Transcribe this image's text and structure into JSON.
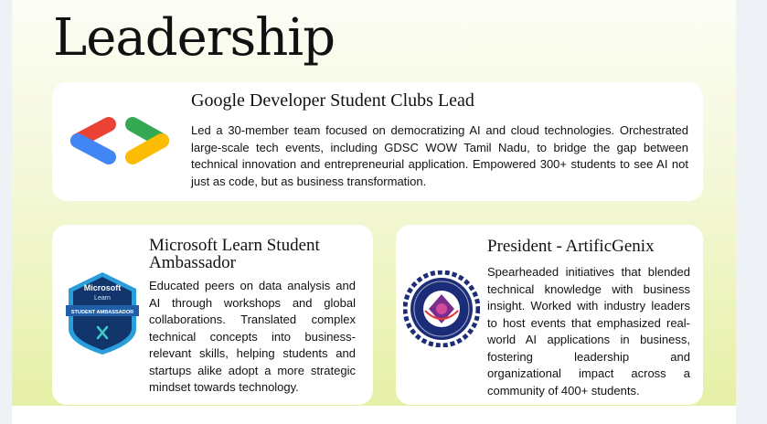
{
  "page": {
    "title": "Leadership"
  },
  "cards": {
    "gdsc": {
      "title": "Google Developer Student Clubs Lead",
      "text": "Led a 30-member team focused on democratizing AI and cloud technologies. Orchestrated large-scale tech events, including GDSC WOW Tamil Nadu, to bridge the gap between technical innovation and entrepreneurial application. Empowered 300+ students to see AI not just as code, but as business transformation.",
      "icon": "google-developers-logo"
    },
    "microsoft": {
      "title": "Microsoft Learn Student Ambassador",
      "text": "Educated peers on data analysis and AI through workshops and global collaborations. Translated complex technical concepts into business-relevant skills, helping students and startups alike adopt a more strategic mindset towards technology.",
      "icon": "microsoft-learn-student-ambassador-badge",
      "badge_line1": "Microsoft",
      "badge_line2": "Learn",
      "badge_ribbon": "STUDENT AMBASSADOR"
    },
    "artificgenix": {
      "title": "President - ArtificGenix",
      "text": "Spearheaded initiatives that blended technical knowledge with business insight. Worked with industry leaders to host events that emphasized real-world AI applications in business, fostering leadership and organizational impact across a community of 400+ students.",
      "icon": "college-emblem"
    }
  },
  "colors": {
    "google_red": "#EA4335",
    "google_blue": "#4285F4",
    "google_green": "#34A853",
    "google_yellow": "#FBBC04",
    "ms_badge_blue": "#1f5fa8",
    "college_navy": "#1b2c78",
    "college_purple": "#7b2d8e"
  }
}
